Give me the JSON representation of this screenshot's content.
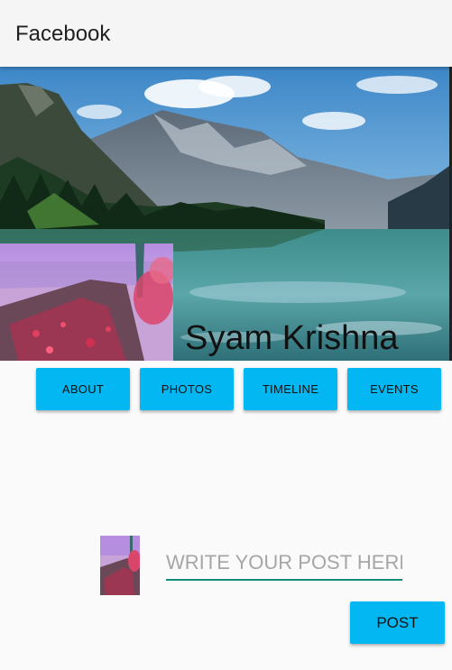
{
  "appbar": {
    "title": "Facebook"
  },
  "profile": {
    "name": "Syam Krishna",
    "cover_photo": "mountain-lake-photo",
    "profile_photo": "pink-pier-photo"
  },
  "tabs": [
    {
      "label": "ABOUT"
    },
    {
      "label": "PHOTOS"
    },
    {
      "label": "TIMELINE"
    },
    {
      "label": "EVENTS"
    }
  ],
  "composer": {
    "placeholder": "WRITE YOUR POST HERE",
    "value": "",
    "post_label": "POST"
  },
  "colors": {
    "accent": "#03b8f2",
    "input_underline": "#128c7e",
    "appbar": "#f5f5f5"
  }
}
